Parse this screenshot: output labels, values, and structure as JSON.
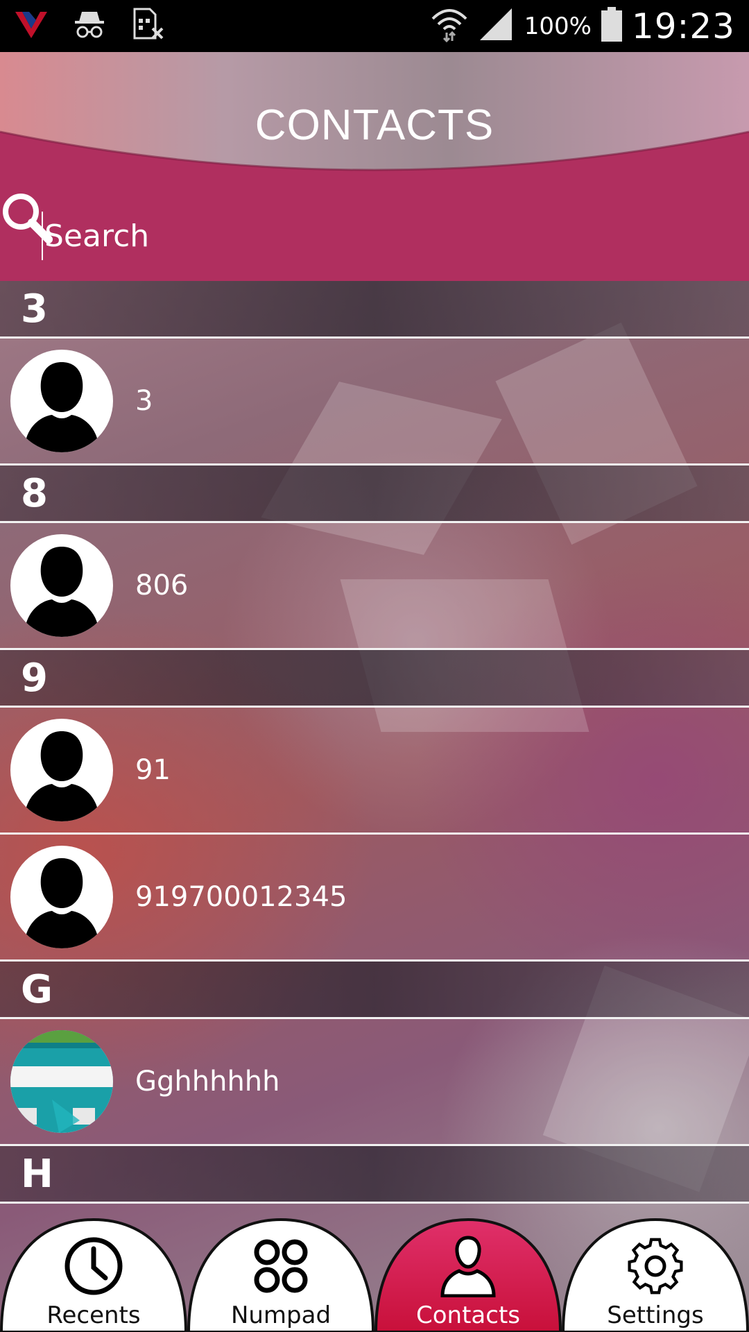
{
  "status_bar": {
    "battery": "100%",
    "time": "19:23",
    "icons": [
      "app-logo-icon",
      "incognito-icon",
      "sim-off-icon",
      "wifi-icon",
      "signal-icon",
      "battery-icon"
    ]
  },
  "header": {
    "title": "CONTACTS",
    "accent_color": "#b02f5f"
  },
  "search": {
    "placeholder": "Search"
  },
  "sections": [
    {
      "letter": "3",
      "contacts": [
        {
          "name": "3",
          "avatar": "default"
        }
      ]
    },
    {
      "letter": "8",
      "contacts": [
        {
          "name": "806",
          "avatar": "default"
        }
      ]
    },
    {
      "letter": "9",
      "contacts": [
        {
          "name": "91",
          "avatar": "default"
        },
        {
          "name": "919700012345",
          "avatar": "default"
        }
      ]
    },
    {
      "letter": "G",
      "contacts": [
        {
          "name": "Gghhhhhh",
          "avatar": "photo"
        }
      ]
    },
    {
      "letter": "H",
      "contacts": []
    }
  ],
  "nav": {
    "active": "contacts",
    "tabs": [
      {
        "id": "recents",
        "label": "Recents",
        "icon": "clock-icon"
      },
      {
        "id": "numpad",
        "label": "Numpad",
        "icon": "numpad-icon"
      },
      {
        "id": "contacts",
        "label": "Contacts",
        "icon": "person-icon"
      },
      {
        "id": "settings",
        "label": "Settings",
        "icon": "gear-icon"
      }
    ],
    "active_color": "#c8103a"
  }
}
